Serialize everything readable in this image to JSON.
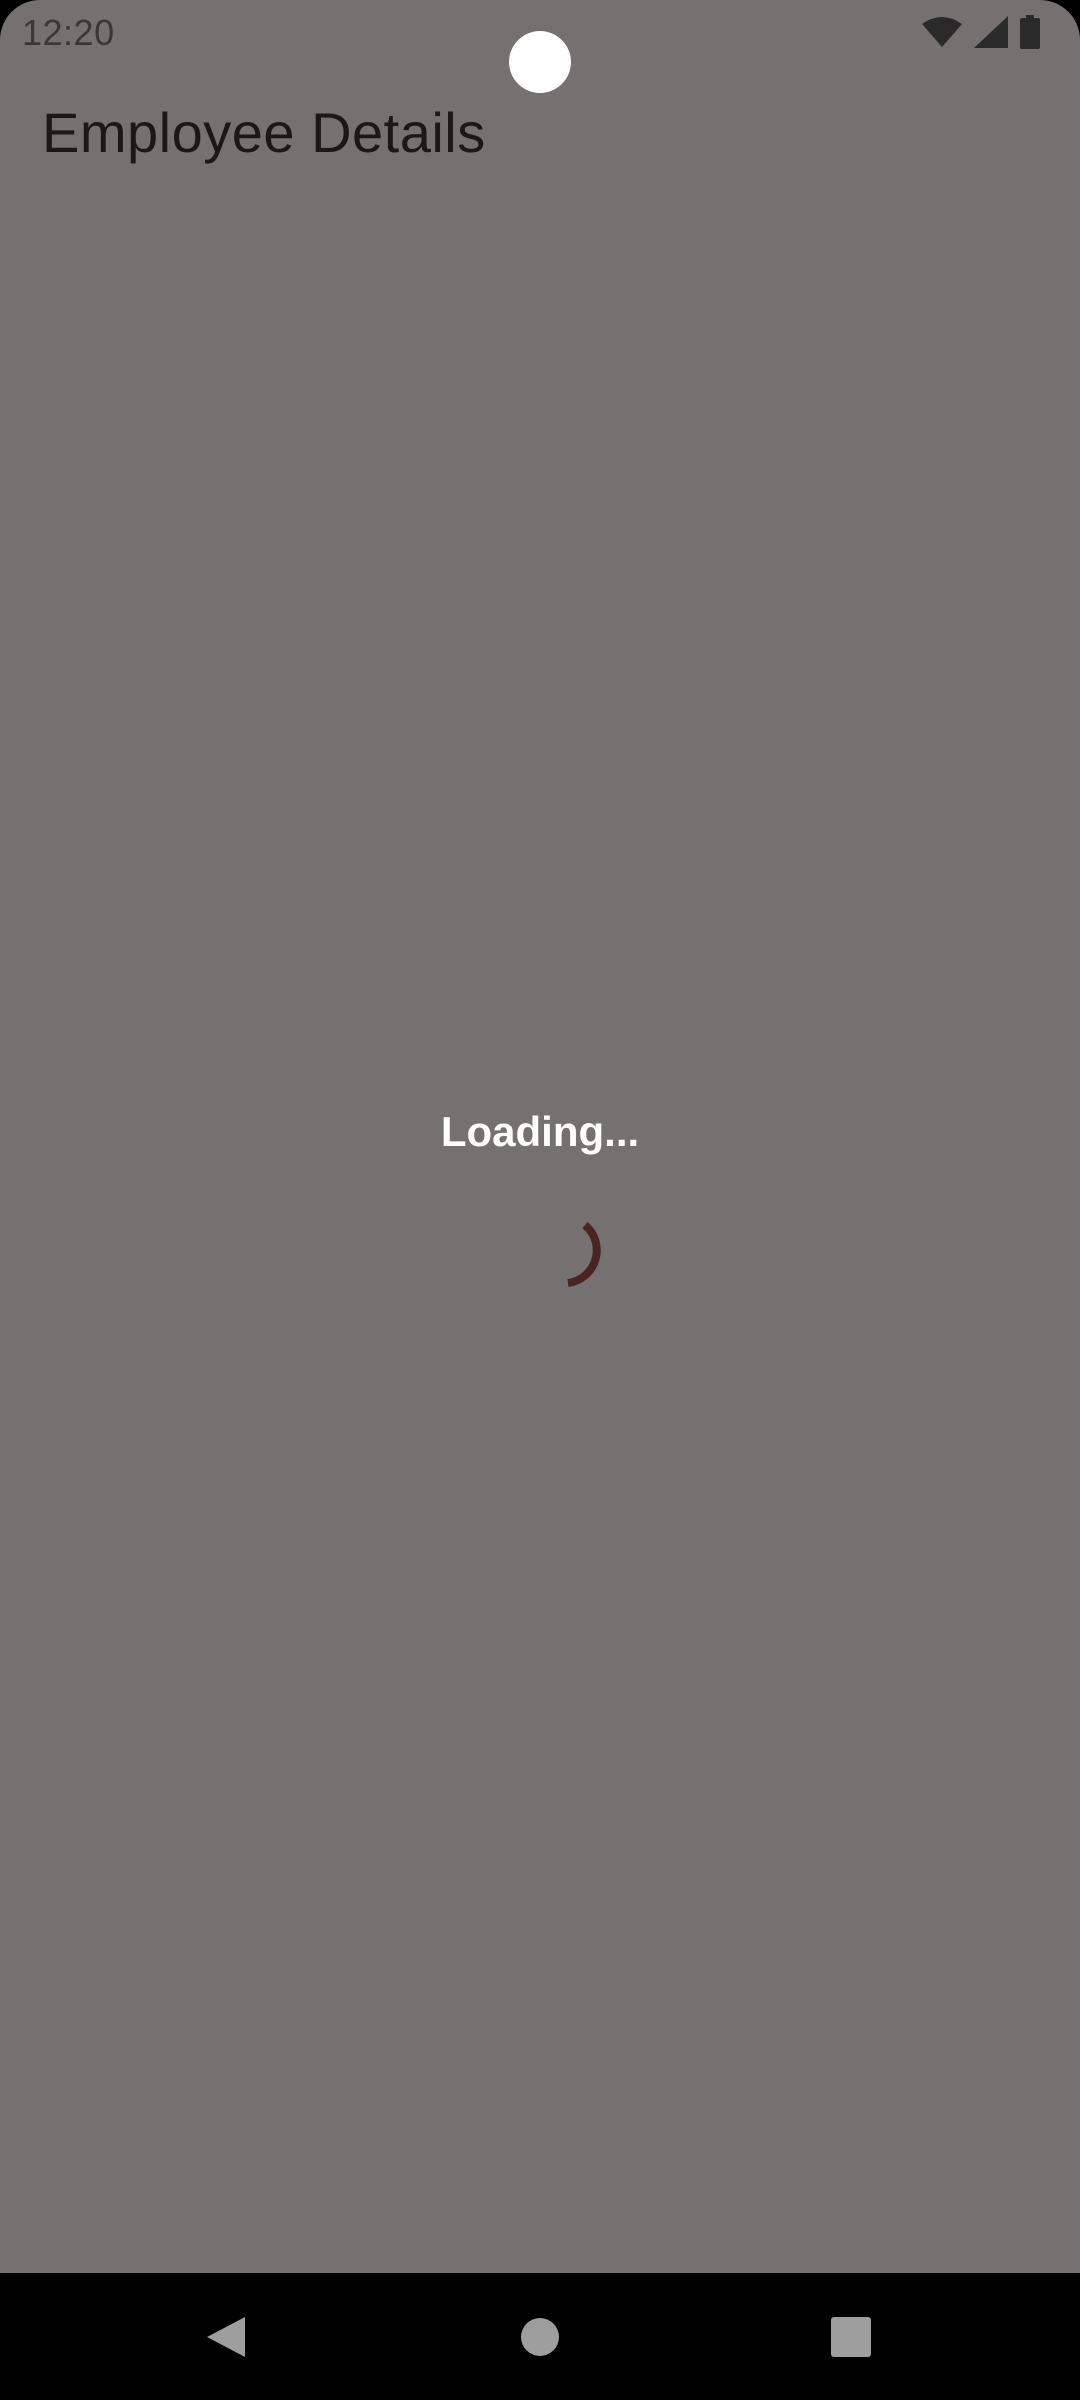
{
  "status_bar": {
    "time": "12:20",
    "icons": [
      "wifi-icon",
      "signal-icon",
      "battery-icon"
    ]
  },
  "app": {
    "title": "Employee Details"
  },
  "loading": {
    "text": "Loading...",
    "spinner_color": "#4a2420"
  },
  "nav_bar": {
    "buttons": [
      "back-icon",
      "home-icon",
      "recents-icon"
    ],
    "icon_color": "#9e9e9e"
  },
  "colors": {
    "background": "#757170",
    "title_text": "#1a1818",
    "loading_text": "#ffffff"
  }
}
